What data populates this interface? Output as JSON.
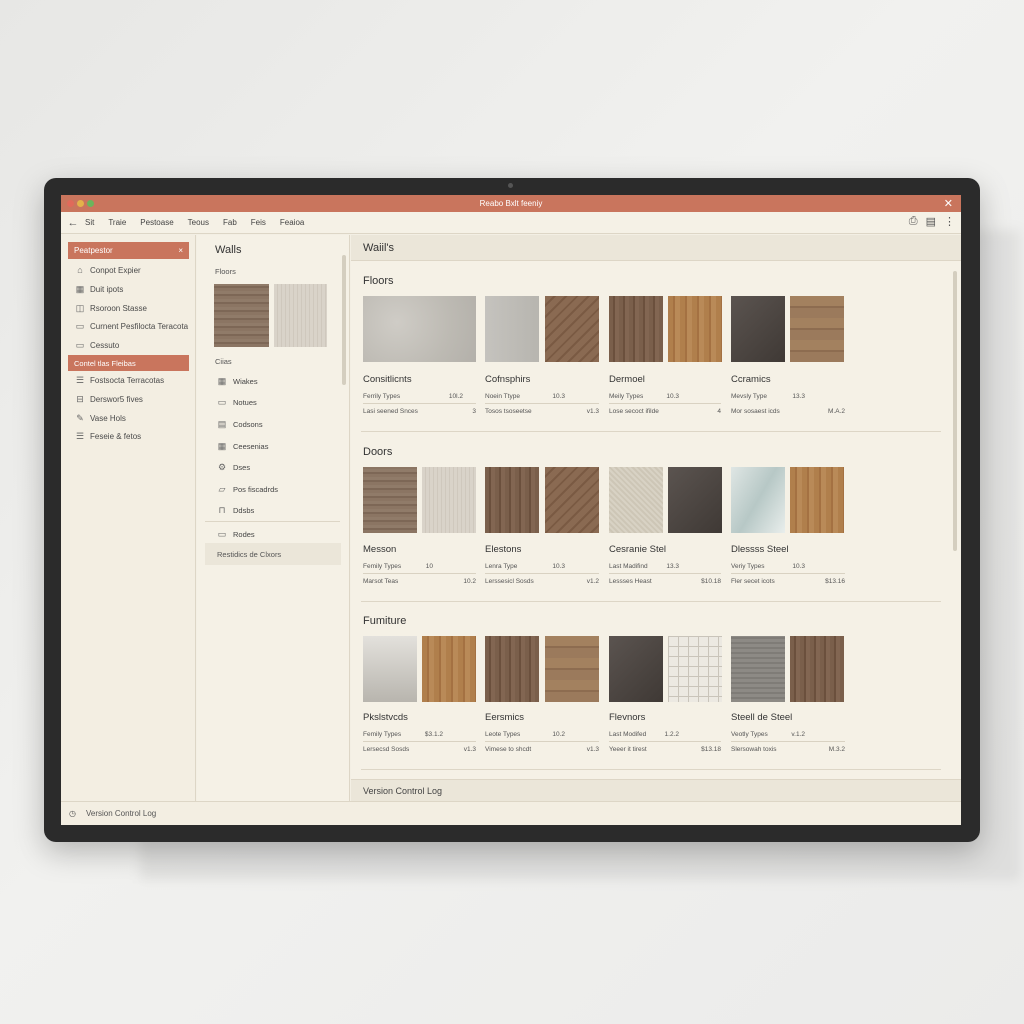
{
  "window": {
    "title": "Reabo Bxlt feeniy"
  },
  "menu": {
    "items": [
      "Sit",
      "Traie",
      "Pestoase",
      "Teous",
      "Fab",
      "Feis",
      "Feaioa"
    ]
  },
  "left_panel": {
    "header": "Peatpestor",
    "items": [
      {
        "label": "Conpot Expier"
      },
      {
        "label": "Duit ipots"
      },
      {
        "label": "Rsoroon Stasse"
      },
      {
        "label": "Curnent Pesfilocta Teracota"
      },
      {
        "label": "Cessuto"
      }
    ],
    "active": "Contel tlas Fleibas",
    "items2": [
      {
        "label": "Fostsocta Terracotas"
      },
      {
        "label": "Derswor5 fives"
      },
      {
        "label": "Vase Hols"
      },
      {
        "label": "Feseie & fetos"
      }
    ]
  },
  "mid_panel": {
    "title": "Walls",
    "sub": "Floors",
    "sub2": "Ciias",
    "items": [
      {
        "label": "Wiakes"
      },
      {
        "label": "Notues"
      },
      {
        "label": "Codsons"
      },
      {
        "label": "Ceesenias"
      },
      {
        "label": "Dses"
      },
      {
        "label": "Pos fiscadrds"
      },
      {
        "label": "Ddsbs"
      },
      {
        "label": "Rodes"
      }
    ],
    "footer": "Restidics de Clxors"
  },
  "main_panel": {
    "header": "Waiil's",
    "sections": [
      {
        "title": "Floors",
        "cards": [
          {
            "name": "Consitlicnts",
            "meta1_l": "Ferrily Types",
            "meta1_r": "10l.2",
            "meta2_l": "Lasi seened Snces",
            "meta2_r": "3"
          },
          {
            "name": "Cofnsphirs",
            "meta1_l": "Noein Ttype",
            "meta1_r": "10.3",
            "meta2_l": "Tosos tsoseetse",
            "meta2_r": "v1.3"
          },
          {
            "name": "Dermoel",
            "meta1_l": "Meily Types",
            "meta1_r": "10.3",
            "meta2_l": "Lose secoct ifilde",
            "meta2_r": "4"
          },
          {
            "name": "Ccramics",
            "meta1_l": "Mevsly Type",
            "meta1_r": "13.3",
            "meta2_l": "Mor sosaest icds",
            "meta2_r": "M.A.2"
          }
        ]
      },
      {
        "title": "Doors",
        "cards": [
          {
            "name": "Messon",
            "meta1_l": "Femily Types",
            "meta1_r": "10",
            "meta2_l": "Marsot Teas",
            "meta2_r": "10.2"
          },
          {
            "name": "Elestons",
            "meta1_l": "Lenra Type",
            "meta1_r": "10.3",
            "meta2_l": "Lerssesicl Sosds",
            "meta2_r": "v1.2"
          },
          {
            "name": "Cesranie Stel",
            "meta1_l": "Last Madifind",
            "meta1_r": "13.3",
            "meta2_l": "Lessses Heast",
            "meta2_r": "$10.18"
          },
          {
            "name": "Dlessss Steel",
            "meta1_l": "Veriy Types",
            "meta1_r": "10.3",
            "meta2_l": "Fler secet icots",
            "meta2_r": "$13.16"
          }
        ]
      },
      {
        "title": "Fumiture",
        "cards": [
          {
            "name": "Pkslstvcds",
            "meta1_l": "Femily Types",
            "meta1_r": "$3.1.2",
            "meta2_l": "Lersecsd Sosds",
            "meta2_r": "v1.3"
          },
          {
            "name": "Eersmics",
            "meta1_l": "Leote Types",
            "meta1_r": "10.2",
            "meta2_l": "Vimese to shcdt",
            "meta2_r": "v1.3"
          },
          {
            "name": "Flevnors",
            "meta1_l": "Last Modifed",
            "meta1_r": "1.2.2",
            "meta2_l": "Yeeer it tirest",
            "meta2_r": "$13.18"
          },
          {
            "name": "Steell de Steel",
            "meta1_l": "Veotly Types",
            "meta1_r": "v.1.2",
            "meta2_l": "Slersowah toxis",
            "meta2_r": "M.3.2"
          }
        ]
      }
    ],
    "footer": "Version Control Log"
  },
  "status": {
    "text": "Version Control Log"
  },
  "colors": {
    "accent": "#c9755d",
    "panel": "#f5f1e6",
    "frame": "#2b2b2b"
  }
}
